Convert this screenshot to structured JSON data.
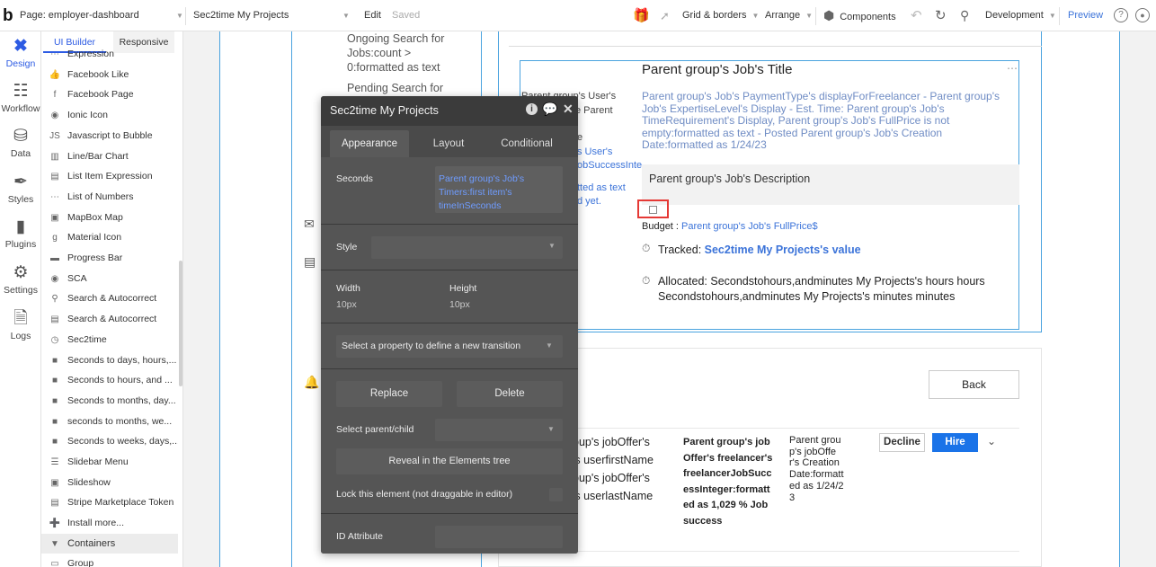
{
  "topbar": {
    "logo": "b",
    "page_select": "Page: employer-dashboard",
    "element_select": "Sec2time My Projects",
    "edit": "Edit",
    "saved": "Saved",
    "grid_borders": "Grid & borders",
    "arrange": "Arrange",
    "components": "Components",
    "development": "Development",
    "preview": "Preview"
  },
  "rail": [
    {
      "label": "Design",
      "icon": "design-icon"
    },
    {
      "label": "Workflow",
      "icon": "workflow-icon"
    },
    {
      "label": "Data",
      "icon": "data-icon"
    },
    {
      "label": "Styles",
      "icon": "styles-icon"
    },
    {
      "label": "Plugins",
      "icon": "plugins-icon"
    },
    {
      "label": "Settings",
      "icon": "settings-icon"
    },
    {
      "label": "Logs",
      "icon": "logs-icon"
    }
  ],
  "panel": {
    "tabs": [
      "UI Builder",
      "Responsive"
    ],
    "items": [
      "Expression",
      "Facebook Like",
      "Facebook Page",
      "Ionic Icon",
      "Javascript to Bubble",
      "Line/Bar Chart",
      "List Item Expression",
      "List of Numbers",
      "MapBox Map",
      "Material Icon",
      "Progress Bar",
      "SCA",
      "Search & Autocorrect",
      "Search & Autocorrect",
      "Sec2time",
      "Seconds to days, hours,...",
      "Seconds to hours, and ...",
      "Seconds to months, day...",
      "seconds to months, we...",
      "Seconds to weeks, days,...",
      "Slidebar Menu",
      "Slideshow",
      "Stripe Marketplace Token",
      "Install more..."
    ],
    "containers": "Containers",
    "group": "Group"
  },
  "canvas": {
    "ongoing_search": "Ongoing Search for Jobs:count > 0:formatted as text",
    "pending_search": "Pending Search for",
    "behind_fragments": [
      "Parent group's User's",
      "e Parent",
      "e",
      "s User's",
      "obSuccessInte",
      "tted as text",
      "d yet."
    ],
    "job_title": "Parent group's Job's Title",
    "job_meta": "Parent group's Job's PaymentType's displayForFreelancer - Parent group's Job's ExpertiseLevel's Display - Est. Time: Parent group's Job's TimeRequirement's Display, Parent group's Job's FullPrice is not empty:formatted as text - Posted Parent group's Job's Creation Date:formatted as 1/24/23",
    "job_description": "Parent group's Job's Description",
    "budget_label": "Budget : ",
    "budget_value": "Parent group's Job's FullPrice$",
    "tracked_label": "Tracked: ",
    "tracked_value": "Sec2time My Projects's value",
    "allocated": "Allocated: Secondstohours,andminutes My Projects's hours hours Secondstohours,andminutes My Projects's minutes minutes",
    "back_button": "Back",
    "offer_names": [
      "oup's jobOffer's",
      "'s userfirstName",
      "oup's jobOffer's",
      "'s userlastName"
    ],
    "offer_success": "Parent group's jobOffer's freelancer's freelancerJobSuccessInteger:formatted as 1,029 % Job success",
    "offer_date": "Parent group's jobOffer's Creation Date:formatted as 1/24/23",
    "decline": "Decline",
    "hire": "Hire"
  },
  "property_editor": {
    "title": "Sec2time My Projects",
    "tabs": [
      "Appearance",
      "Layout",
      "Conditional"
    ],
    "seconds_label": "Seconds",
    "seconds_value": "Parent group's Job's Timers:first item's timeInSeconds",
    "style_label": "Style",
    "width_label": "Width",
    "width_value": "10px",
    "height_label": "Height",
    "height_value": "10px",
    "transition": "Select a property to define a new transition",
    "replace": "Replace",
    "delete": "Delete",
    "select_parent": "Select parent/child",
    "reveal": "Reveal in the Elements tree",
    "lock": "Lock this element (not draggable in editor)",
    "id_attribute": "ID Attribute"
  },
  "colors": {
    "accent": "#3b73d9",
    "hire": "#1a73e8",
    "selection": "#e53935"
  }
}
